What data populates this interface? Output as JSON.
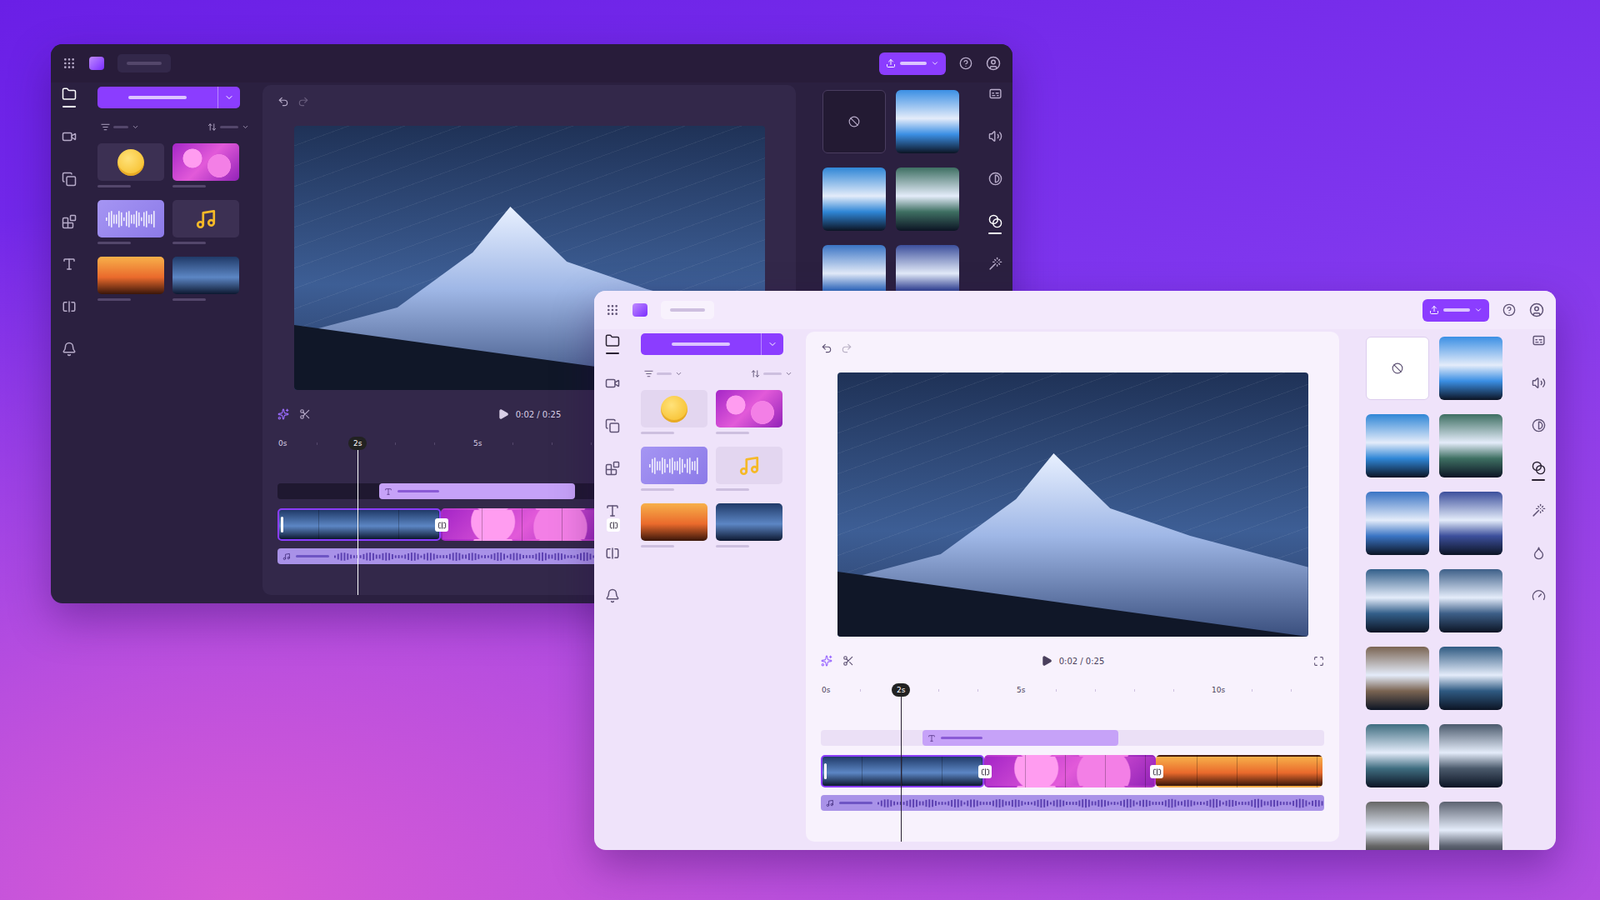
{
  "windows": [
    {
      "kind": "dark",
      "left_rail": [
        {
          "selected": true
        },
        {
          "selected": false
        },
        {
          "selected": false
        },
        {
          "selected": false
        },
        {
          "selected": false
        },
        {
          "selected": false
        },
        {
          "selected": false
        }
      ],
      "media": [
        {
          "kind": "emoji"
        },
        {
          "kind": "bokeh"
        },
        {
          "kind": "wave"
        },
        {
          "kind": "note"
        },
        {
          "kind": "sunset"
        },
        {
          "kind": "mountain"
        }
      ],
      "time": "0:02 / 0:25",
      "ruler": [
        "0s",
        "5s"
      ],
      "playhead": {
        "label": "2s",
        "level": 0.16
      },
      "clips": [
        {
          "kind": "mountain",
          "selected": true
        },
        {
          "kind": "bokeh",
          "selected": false
        },
        {
          "kind": "sunset",
          "selected": false
        }
      ],
      "filters": [
        {
          "kind": "none"
        },
        {
          "kind": "photo"
        },
        {
          "kind": "photo"
        },
        {
          "kind": "photo"
        },
        {
          "kind": "photo"
        },
        {
          "kind": "photo"
        }
      ],
      "right_rail": [
        {
          "selected": false
        },
        {
          "selected": false
        },
        {
          "selected": false
        },
        {
          "selected": true
        },
        {
          "selected": false
        }
      ]
    },
    {
      "kind": "light",
      "left_rail": [
        {
          "selected": true
        },
        {
          "selected": false
        },
        {
          "selected": false
        },
        {
          "selected": false
        },
        {
          "selected": false
        },
        {
          "selected": false
        },
        {
          "selected": false
        }
      ],
      "media": [
        {
          "kind": "emoji"
        },
        {
          "kind": "bokeh"
        },
        {
          "kind": "wave"
        },
        {
          "kind": "note"
        },
        {
          "kind": "sunset"
        },
        {
          "kind": "mountain"
        }
      ],
      "time": "0:02 / 0:25",
      "ruler": [
        "0s",
        "5s",
        "10s"
      ],
      "playhead": {
        "label": "2s",
        "level": 0.16
      },
      "clips": [
        {
          "kind": "mountain",
          "selected": true
        },
        {
          "kind": "bokeh",
          "selected": false
        },
        {
          "kind": "sunset",
          "selected": false
        }
      ],
      "filters": [
        {
          "kind": "none"
        },
        {
          "kind": "photo"
        },
        {
          "kind": "photo"
        },
        {
          "kind": "photo"
        },
        {
          "kind": "photo"
        },
        {
          "kind": "photo"
        },
        {
          "kind": "photo"
        },
        {
          "kind": "photo"
        },
        {
          "kind": "photo"
        },
        {
          "kind": "photo"
        },
        {
          "kind": "photo"
        },
        {
          "kind": "photo"
        },
        {
          "kind": "photo"
        },
        {
          "kind": "photo"
        }
      ],
      "right_rail": [
        {
          "selected": false
        },
        {
          "selected": false
        },
        {
          "selected": false
        },
        {
          "selected": true
        },
        {
          "selected": false
        },
        {
          "selected": false
        },
        {
          "selected": false
        }
      ]
    }
  ]
}
